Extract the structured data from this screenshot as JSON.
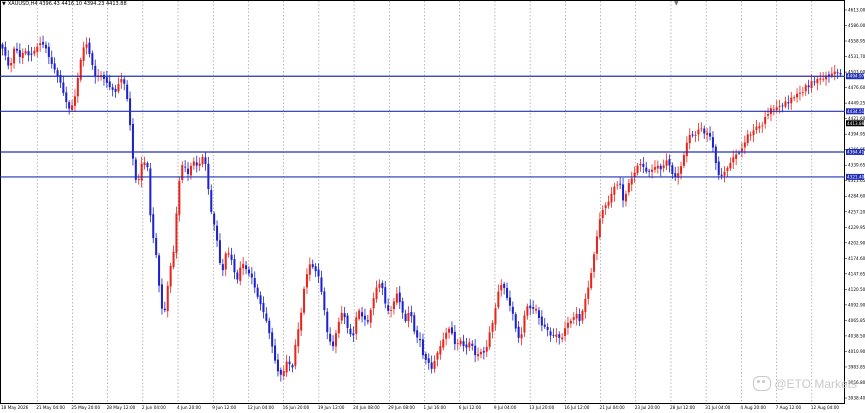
{
  "chart_header": {
    "arrow": "▼",
    "info": "XAUUSD,H4  4396.43 4416.10 4394.23 4413.88"
  },
  "watermark": {
    "icon": "chat-bubble-icon",
    "text": "@ETO Markets"
  },
  "colors": {
    "bull": "#e8251c",
    "bear": "#1c22cc",
    "level_line": "#2230b8",
    "grid": "#8c8c8c",
    "label_bg": "#2230b8",
    "axis_text": "#000000"
  },
  "chart_data": {
    "type": "candlestick",
    "symbol": "XAUUSD",
    "timeframe": "H4",
    "ohlc_current": {
      "open": 4396.43,
      "high": 4416.1,
      "low": 4394.23,
      "close": 4413.88
    },
    "ylim": [
      3930,
      4616
    ],
    "y_tick_labels": [
      "4613.00",
      "4586.00",
      "4558.95",
      "4531.70",
      "4503.60",
      "4476.60",
      "4449.25",
      "4421.60",
      "4394.95",
      "4366.85",
      "4339.65",
      "4311.65",
      "4284.60",
      "4257.20",
      "4229.95",
      "4202.90",
      "4174.60",
      "4147.65",
      "4120.50",
      "4092.90",
      "4065.85",
      "4038.50",
      "4010.90",
      "3983.85",
      "3956.80",
      "3938.40"
    ],
    "x_tick_labels": [
      "18 May 2026",
      "21 May 04:00",
      "25 May 20:00",
      "28 May 12:00",
      "2 Jun 04:00",
      "4 Jun 20:00",
      "9 Jun 12:00",
      "12 Jun 04:00",
      "16 Jun 20:00",
      "19 Jun 12:00",
      "24 Jun 08:00",
      "29 Jun 08:00",
      "1 Jul 16:00",
      "6 Jul 12:00",
      "9 Jul 04:00",
      "13 Jul 20:00",
      "16 Jul 12:00",
      "21 Jul 04:00",
      "23 Jul 20:00",
      "28 Jul 12:00",
      "31 Jul 04:00",
      "4 Aug 20:00",
      "7 Aug 12:00",
      "12 Aug 04:00"
    ],
    "horizontal_levels": [
      {
        "price": 4494.97,
        "label": "4494.97"
      },
      {
        "price": 4434.51,
        "label": "4434.51"
      },
      {
        "price": 4364.41,
        "label": "4364.41"
      },
      {
        "price": 4321.4,
        "label": "4321.40"
      }
    ],
    "current_price": {
      "price": 4413.88,
      "label": "4413.88"
    },
    "path_waypoints": [
      [
        0,
        4553
      ],
      [
        6,
        4535
      ],
      [
        12,
        4505
      ],
      [
        18,
        4548
      ],
      [
        24,
        4528
      ],
      [
        30,
        4540
      ],
      [
        36,
        4528
      ],
      [
        42,
        4540
      ],
      [
        48,
        4552
      ],
      [
        54,
        4548
      ],
      [
        60,
        4522
      ],
      [
        66,
        4505
      ],
      [
        72,
        4486
      ],
      [
        78,
        4455
      ],
      [
        84,
        4435
      ],
      [
        90,
        4462
      ],
      [
        96,
        4520
      ],
      [
        102,
        4557
      ],
      [
        108,
        4528
      ],
      [
        114,
        4493
      ],
      [
        120,
        4498
      ],
      [
        126,
        4487
      ],
      [
        132,
        4474
      ],
      [
        138,
        4468
      ],
      [
        144,
        4492
      ],
      [
        150,
        4478
      ],
      [
        156,
        4400
      ],
      [
        160,
        4328
      ],
      [
        164,
        4306
      ],
      [
        170,
        4352
      ],
      [
        176,
        4338
      ],
      [
        180,
        4238
      ],
      [
        186,
        4190
      ],
      [
        192,
        4098
      ],
      [
        196,
        4085
      ],
      [
        202,
        4158
      ],
      [
        208,
        4200
      ],
      [
        212,
        4300
      ],
      [
        218,
        4348
      ],
      [
        224,
        4326
      ],
      [
        230,
        4350
      ],
      [
        236,
        4338
      ],
      [
        242,
        4358
      ],
      [
        246,
        4338
      ],
      [
        250,
        4272
      ],
      [
        256,
        4234
      ],
      [
        260,
        4200
      ],
      [
        264,
        4148
      ],
      [
        270,
        4198
      ],
      [
        276,
        4178
      ],
      [
        282,
        4140
      ],
      [
        288,
        4176
      ],
      [
        294,
        4160
      ],
      [
        300,
        4148
      ],
      [
        306,
        4118
      ],
      [
        312,
        4096
      ],
      [
        318,
        4070
      ],
      [
        324,
        4030
      ],
      [
        330,
        3988
      ],
      [
        336,
        3978
      ],
      [
        342,
        4006
      ],
      [
        348,
        3990
      ],
      [
        352,
        4035
      ],
      [
        358,
        4080
      ],
      [
        362,
        4128
      ],
      [
        368,
        4172
      ],
      [
        374,
        4164
      ],
      [
        380,
        4148
      ],
      [
        386,
        4094
      ],
      [
        390,
        4050
      ],
      [
        396,
        4026
      ],
      [
        402,
        4065
      ],
      [
        408,
        4092
      ],
      [
        414,
        4060
      ],
      [
        420,
        4042
      ],
      [
        426,
        4096
      ],
      [
        432,
        4078
      ],
      [
        438,
        4072
      ],
      [
        444,
        4108
      ],
      [
        450,
        4140
      ],
      [
        456,
        4128
      ],
      [
        460,
        4090
      ],
      [
        466,
        4092
      ],
      [
        472,
        4122
      ],
      [
        478,
        4096
      ],
      [
        482,
        4070
      ],
      [
        488,
        4094
      ],
      [
        494,
        4048
      ],
      [
        500,
        4040
      ],
      [
        504,
        4010
      ],
      [
        510,
        4002
      ],
      [
        514,
        3990
      ],
      [
        520,
        4016
      ],
      [
        526,
        4036
      ],
      [
        532,
        4056
      ],
      [
        536,
        4062
      ],
      [
        542,
        4030
      ],
      [
        548,
        4040
      ],
      [
        554,
        4024
      ],
      [
        560,
        4040
      ],
      [
        566,
        4012
      ],
      [
        572,
        4020
      ],
      [
        578,
        4018
      ],
      [
        582,
        4050
      ],
      [
        588,
        4078
      ],
      [
        592,
        4120
      ],
      [
        598,
        4140
      ],
      [
        604,
        4110
      ],
      [
        610,
        4088
      ],
      [
        616,
        4044
      ],
      [
        620,
        4044
      ],
      [
        626,
        4100
      ],
      [
        632,
        4094
      ],
      [
        638,
        4094
      ],
      [
        644,
        4066
      ],
      [
        650,
        4062
      ],
      [
        656,
        4046
      ],
      [
        662,
        4050
      ],
      [
        668,
        4040
      ],
      [
        674,
        4068
      ],
      [
        680,
        4074
      ],
      [
        686,
        4086
      ],
      [
        690,
        4072
      ],
      [
        696,
        4108
      ],
      [
        702,
        4142
      ],
      [
        706,
        4180
      ],
      [
        710,
        4216
      ],
      [
        714,
        4250
      ],
      [
        718,
        4268
      ],
      [
        724,
        4278
      ],
      [
        728,
        4294
      ],
      [
        732,
        4308
      ],
      [
        738,
        4308
      ],
      [
        742,
        4276
      ],
      [
        748,
        4310
      ],
      [
        754,
        4324
      ],
      [
        758,
        4340
      ],
      [
        762,
        4344
      ],
      [
        766,
        4338
      ],
      [
        770,
        4328
      ],
      [
        776,
        4334
      ],
      [
        782,
        4342
      ],
      [
        786,
        4334
      ],
      [
        790,
        4342
      ],
      [
        794,
        4352
      ],
      [
        798,
        4335
      ],
      [
        802,
        4318
      ],
      [
        806,
        4325
      ],
      [
        810,
        4338
      ],
      [
        814,
        4360
      ],
      [
        818,
        4385
      ],
      [
        822,
        4398
      ],
      [
        826,
        4388
      ],
      [
        830,
        4402
      ],
      [
        834,
        4406
      ],
      [
        838,
        4396
      ],
      [
        842,
        4398
      ],
      [
        846,
        4388
      ],
      [
        850,
        4360
      ],
      [
        854,
        4326
      ],
      [
        858,
        4322
      ],
      [
        862,
        4330
      ],
      [
        866,
        4338
      ],
      [
        870,
        4348
      ],
      [
        874,
        4360
      ],
      [
        878,
        4360
      ],
      [
        882,
        4368
      ],
      [
        886,
        4380
      ],
      [
        890,
        4396
      ],
      [
        894,
        4394
      ],
      [
        898,
        4406
      ],
      [
        902,
        4410
      ],
      [
        906,
        4406
      ],
      [
        910,
        4424
      ],
      [
        914,
        4430
      ],
      [
        918,
        4442
      ],
      [
        922,
        4436
      ],
      [
        926,
        4446
      ],
      [
        930,
        4440
      ],
      [
        934,
        4452
      ],
      [
        938,
        4448
      ],
      [
        942,
        4460
      ],
      [
        946,
        4458
      ],
      [
        950,
        4470
      ],
      [
        954,
        4462
      ],
      [
        958,
        4480
      ],
      [
        962,
        4476
      ],
      [
        966,
        4488
      ],
      [
        970,
        4484
      ],
      [
        974,
        4494
      ],
      [
        978,
        4488
      ],
      [
        982,
        4496
      ],
      [
        986,
        4494
      ],
      [
        990,
        4500
      ],
      [
        994,
        4504
      ],
      [
        998,
        4500
      ],
      [
        1002,
        4496
      ]
    ]
  }
}
